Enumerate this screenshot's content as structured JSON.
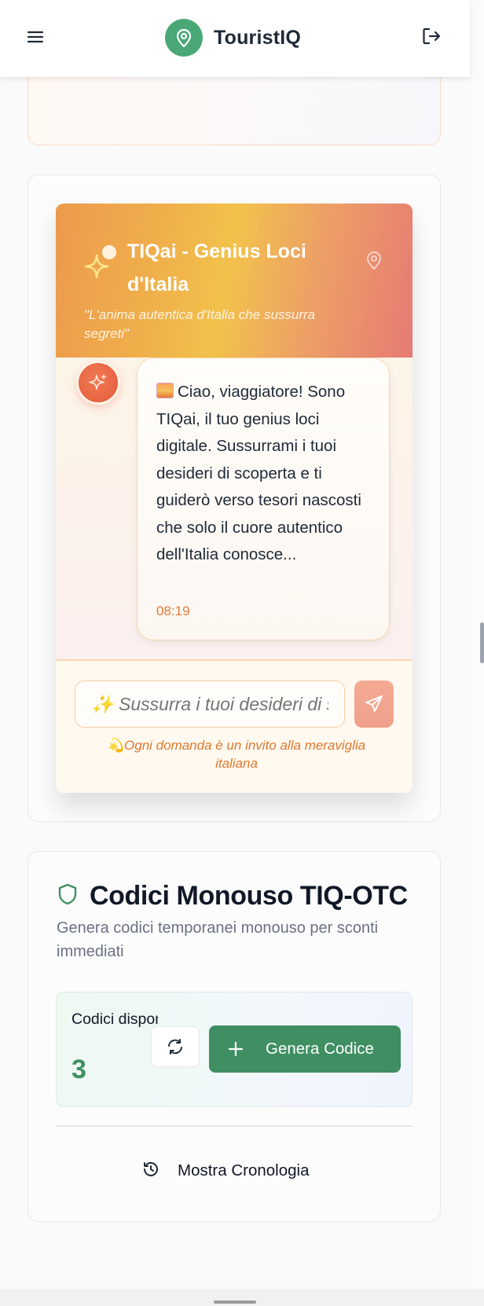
{
  "app": {
    "name": "TouristIQ",
    "brand_color": "#4aa876"
  },
  "header": {
    "menu_icon": "hamburger-menu-icon",
    "logo_icon": "map-pin-icon",
    "logout_icon": "logout-icon"
  },
  "ai_widget": {
    "title": "TIQai - Genius Loci d'Italia",
    "subtitle": "\"L'anima autentica d'Italia che sussurra segreti\"",
    "header_icons": [
      "sparkles-icon",
      "map-pin-icon"
    ],
    "message": {
      "emoji": "sunrise-emoji",
      "text": "Ciao, viaggiatore! Sono TIQai, il tuo genius loci digitale. Sussurrami i tuoi desideri di scoperta e ti guiderò verso tesori nascosti che solo il cuore autentico dell'Italia conosce...",
      "time": "08:19"
    },
    "input_placeholder": "✨ Sussurra i tuoi desideri di scoperta...",
    "hint": "💫Ogni domanda è un invito alla meraviglia italiana",
    "colors": {
      "header_start": "#ec9a4c",
      "header_mid": "#f2c24c",
      "header_end": "#e67b74",
      "accent": "#e07a36"
    }
  },
  "otc": {
    "title": "Codici Monouso TIQ-OTC",
    "description": "Genera codici temporanei monouso per sconti immediati",
    "available_label": "Codici disponibili",
    "available_count": "3",
    "generate_label": "Genera Codice",
    "history_label": "Mostra Cronologia",
    "accent_color": "#3f8f62"
  }
}
